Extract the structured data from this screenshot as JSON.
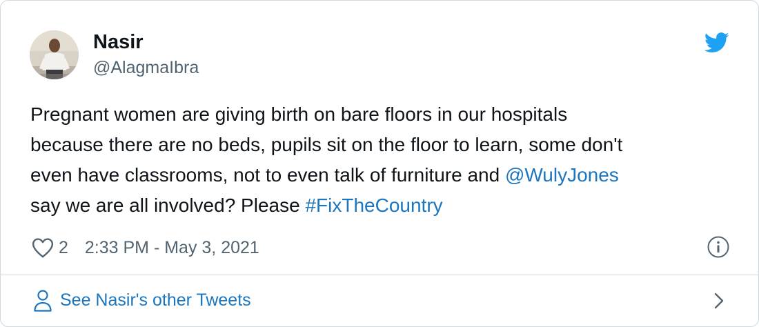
{
  "tweet": {
    "author": {
      "name": "Nasir",
      "handle": "@AlagmaIbra"
    },
    "text_segments": [
      "Pregnant women are giving birth on bare floors in our hospitals",
      "because there are no beds, pupils sit on the floor to learn, some don't",
      "even have classrooms, not to even talk of furniture and ",
      "@WulyJones",
      "say we are all involved? Please ",
      "#FixTheCountry"
    ],
    "likes": "2",
    "timestamp": "2:33 PM - May 3, 2021",
    "footer_link": "See Nasir's other Tweets"
  },
  "icons": {
    "brand": "twitter-bird-icon",
    "like": "heart-icon",
    "info": "info-icon",
    "profile": "person-icon",
    "more": "chevron-right-icon"
  },
  "colors": {
    "twitter_blue": "#1da1f2",
    "link_blue": "#1b76bf",
    "secondary_text": "#536471",
    "border": "#cfd9de"
  }
}
